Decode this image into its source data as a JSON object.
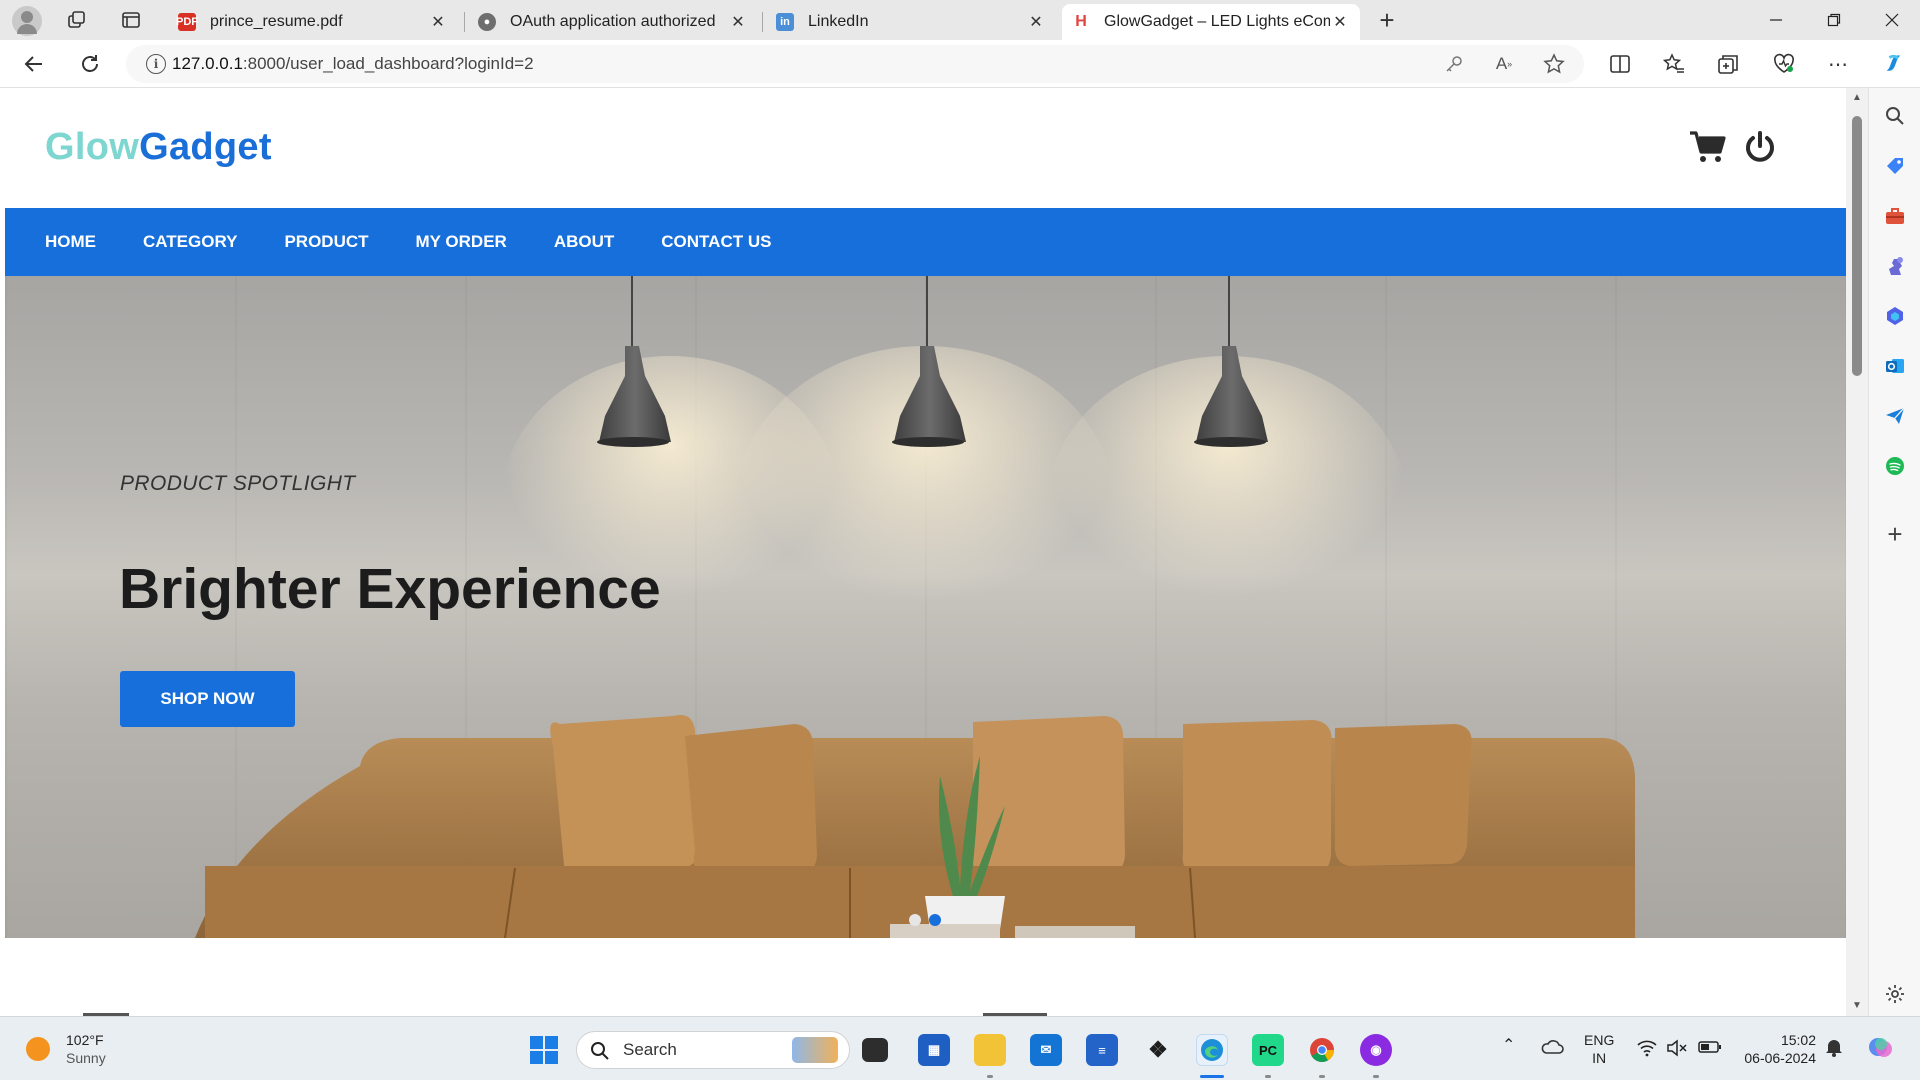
{
  "browser": {
    "tabs": [
      {
        "title": "prince_resume.pdf",
        "icon": "pdf-icon",
        "active": false
      },
      {
        "title": "OAuth application authorized",
        "icon": "github-icon",
        "active": false
      },
      {
        "title": "LinkedIn",
        "icon": "linkedin-icon",
        "active": false
      },
      {
        "title": "GlowGadget – LED Lights eComm",
        "icon": "site-favicon",
        "active": true
      }
    ],
    "new_tab": "+",
    "address": {
      "host": "127.0.0.1",
      "path": ":8000/user_load_dashboard?loginId=2"
    }
  },
  "site": {
    "logo_part1": "Glow",
    "logo_part2": "Gadget",
    "nav": [
      "HOME",
      "CATEGORY",
      "PRODUCT",
      "MY ORDER",
      "ABOUT",
      "CONTACT US"
    ],
    "hero": {
      "subtitle": "PRODUCT SPOTLIGHT",
      "headline": "Brighter Experience",
      "cta": "SHOP NOW",
      "slides": 2,
      "active_slide": 2
    },
    "colors": {
      "primary": "#176fdc",
      "logo_glow": "#7ed6d0",
      "logo_gadget": "#1a6ed8"
    }
  },
  "taskbar": {
    "weather": {
      "temp": "102°F",
      "condition": "Sunny"
    },
    "search_placeholder": "Search",
    "lang_line1": "ENG",
    "lang_line2": "IN",
    "time": "15:02",
    "date": "06-06-2024"
  }
}
